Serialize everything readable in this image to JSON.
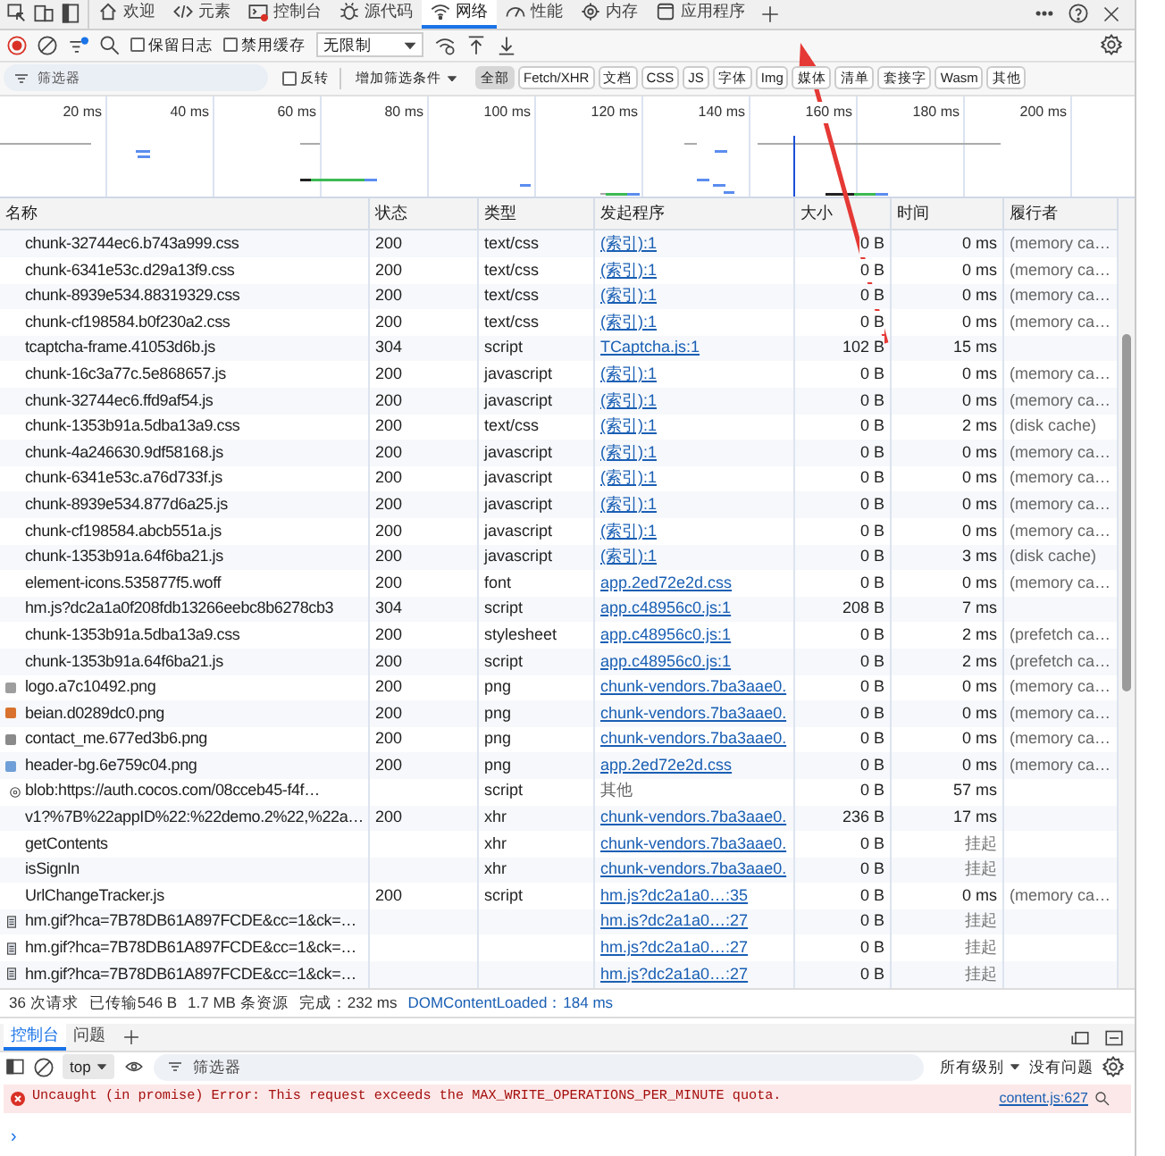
{
  "tabs": [
    {
      "label": "欢迎",
      "selected": false
    },
    {
      "label": "元素",
      "selected": false
    },
    {
      "label": "控制台",
      "selected": false
    },
    {
      "label": "源代码",
      "selected": false
    },
    {
      "label": "网络",
      "selected": true
    },
    {
      "label": "性能",
      "selected": false
    },
    {
      "label": "内存",
      "selected": false
    },
    {
      "label": "应用程序",
      "selected": false
    }
  ],
  "toolbar": {
    "preserve_log": {
      "label": "保留日志",
      "checked": false
    },
    "disable_cache": {
      "label": "禁用缓存",
      "checked": false
    },
    "throttling": "无限制"
  },
  "filter_bar": {
    "placeholder": "筛选器",
    "invert": {
      "label": "反转",
      "checked": false
    },
    "add_filter": "增加筛选条件",
    "chips": [
      {
        "label": "全部",
        "selected": true
      },
      {
        "label": "Fetch/XHR",
        "selected": false
      },
      {
        "label": "文档",
        "selected": false
      },
      {
        "label": "CSS",
        "selected": false
      },
      {
        "label": "JS",
        "selected": false
      },
      {
        "label": "字体",
        "selected": false
      },
      {
        "label": "Img",
        "selected": false
      },
      {
        "label": "媒体",
        "selected": false
      },
      {
        "label": "清单",
        "selected": false
      },
      {
        "label": "套接字",
        "selected": false
      },
      {
        "label": "Wasm",
        "selected": false
      },
      {
        "label": "其他",
        "selected": false
      }
    ]
  },
  "timeline": {
    "ticks": [
      "20 ms",
      "40 ms",
      "60 ms",
      "80 ms",
      "100 ms",
      "120 ms",
      "140 ms",
      "160 ms",
      "180 ms",
      "200 ms"
    ]
  },
  "table": {
    "columns": [
      "名称",
      "状态",
      "类型",
      "发起程序",
      "大小",
      "时间",
      "履行者"
    ],
    "rows": [
      {
        "kind": "plain",
        "name": "chunk-32744ec6.b743a999.css",
        "status": "200",
        "type": "text/css",
        "initiator": "(索引):1",
        "initiator_link": true,
        "size": "0 B",
        "time": "0 ms",
        "pending": false,
        "fulfiller": "(memory ca…"
      },
      {
        "kind": "plain",
        "name": "chunk-6341e53c.d29a13f9.css",
        "status": "200",
        "type": "text/css",
        "initiator": "(索引):1",
        "initiator_link": true,
        "size": "0 B",
        "time": "0 ms",
        "pending": false,
        "fulfiller": "(memory ca…"
      },
      {
        "kind": "plain",
        "name": "chunk-8939e534.88319329.css",
        "status": "200",
        "type": "text/css",
        "initiator": "(索引):1",
        "initiator_link": true,
        "size": "0 B",
        "time": "0 ms",
        "pending": false,
        "fulfiller": "(memory ca…"
      },
      {
        "kind": "plain",
        "name": "chunk-cf198584.b0f230a2.css",
        "status": "200",
        "type": "text/css",
        "initiator": "(索引):1",
        "initiator_link": true,
        "size": "0 B",
        "time": "0 ms",
        "pending": false,
        "fulfiller": "(memory ca…"
      },
      {
        "kind": "plain",
        "name": "tcaptcha-frame.41053d6b.js",
        "status": "304",
        "type": "script",
        "initiator": "TCaptcha.js:1",
        "initiator_link": true,
        "size": "102 B",
        "time": "15 ms",
        "pending": false
      },
      {
        "kind": "plain",
        "name": "chunk-16c3a77c.5e868657.js",
        "status": "200",
        "type": "javascript",
        "initiator": "(索引):1",
        "initiator_link": true,
        "size": "0 B",
        "time": "0 ms",
        "pending": false,
        "fulfiller": "(memory ca…"
      },
      {
        "kind": "plain",
        "name": "chunk-32744ec6.ffd9af54.js",
        "status": "200",
        "type": "javascript",
        "initiator": "(索引):1",
        "initiator_link": true,
        "size": "0 B",
        "time": "0 ms",
        "pending": false,
        "fulfiller": "(memory ca…"
      },
      {
        "kind": "plain",
        "name": "chunk-1353b91a.5dba13a9.css",
        "status": "200",
        "type": "text/css",
        "initiator": "(索引):1",
        "initiator_link": true,
        "size": "0 B",
        "time": "2 ms",
        "pending": false,
        "fulfiller": "(disk cache)"
      },
      {
        "kind": "plain",
        "name": "chunk-4a246630.9df58168.js",
        "status": "200",
        "type": "javascript",
        "initiator": "(索引):1",
        "initiator_link": true,
        "size": "0 B",
        "time": "0 ms",
        "pending": false,
        "fulfiller": "(memory ca…"
      },
      {
        "kind": "plain",
        "name": "chunk-6341e53c.a76d733f.js",
        "status": "200",
        "type": "javascript",
        "initiator": "(索引):1",
        "initiator_link": true,
        "size": "0 B",
        "time": "0 ms",
        "pending": false,
        "fulfiller": "(memory ca…"
      },
      {
        "kind": "plain",
        "name": "chunk-8939e534.877d6a25.js",
        "status": "200",
        "type": "javascript",
        "initiator": "(索引):1",
        "initiator_link": true,
        "size": "0 B",
        "time": "0 ms",
        "pending": false,
        "fulfiller": "(memory ca…"
      },
      {
        "kind": "plain",
        "name": "chunk-cf198584.abcb551a.js",
        "status": "200",
        "type": "javascript",
        "initiator": "(索引):1",
        "initiator_link": true,
        "size": "0 B",
        "time": "0 ms",
        "pending": false,
        "fulfiller": "(memory ca…"
      },
      {
        "kind": "plain",
        "name": "chunk-1353b91a.64f6ba21.js",
        "status": "200",
        "type": "javascript",
        "initiator": "(索引):1",
        "initiator_link": true,
        "size": "0 B",
        "time": "3 ms",
        "pending": false,
        "fulfiller": "(disk cache)"
      },
      {
        "kind": "plain",
        "name": "element-icons.535877f5.woff",
        "status": "200",
        "type": "font",
        "initiator": "app.2ed72e2d.css",
        "initiator_link": true,
        "size": "0 B",
        "time": "0 ms",
        "pending": false,
        "fulfiller": "(memory ca…"
      },
      {
        "kind": "plain",
        "name": "hm.js?dc2a1a0f208fdb13266eebc8b6278cb3",
        "status": "304",
        "type": "script",
        "initiator": "app.c48956c0.js:1",
        "initiator_link": true,
        "size": "208 B",
        "time": "7 ms",
        "pending": false
      },
      {
        "kind": "plain",
        "name": "chunk-1353b91a.5dba13a9.css",
        "status": "200",
        "type": "stylesheet",
        "initiator": "app.c48956c0.js:1",
        "initiator_link": true,
        "size": "0 B",
        "time": "2 ms",
        "pending": false,
        "fulfiller": "(prefetch ca…"
      },
      {
        "kind": "plain",
        "name": "chunk-1353b91a.64f6ba21.js",
        "status": "200",
        "type": "script",
        "initiator": "app.c48956c0.js:1",
        "initiator_link": true,
        "size": "0 B",
        "time": "2 ms",
        "pending": false,
        "fulfiller": "(prefetch ca…"
      },
      {
        "kind": "image",
        "name": "logo.a7c10492.png",
        "status": "200",
        "type": "png",
        "initiator": "chunk-vendors.7ba3aae0.",
        "initiator_link": true,
        "size": "0 B",
        "time": "0 ms",
        "pending": false,
        "fulfiller": "(memory ca…",
        "color": "#9e9e9e"
      },
      {
        "kind": "image",
        "name": "beian.d0289dc0.png",
        "status": "200",
        "type": "png",
        "initiator": "chunk-vendors.7ba3aae0.",
        "initiator_link": true,
        "size": "0 B",
        "time": "0 ms",
        "pending": false,
        "fulfiller": "(memory ca…",
        "color": "#d9722e"
      },
      {
        "kind": "image",
        "name": "contact_me.677ed3b6.png",
        "status": "200",
        "type": "png",
        "initiator": "chunk-vendors.7ba3aae0.",
        "initiator_link": true,
        "size": "0 B",
        "time": "0 ms",
        "pending": false,
        "fulfiller": "(memory ca…",
        "color": "#8a8a8a"
      },
      {
        "kind": "image",
        "name": "header-bg.6e759c04.png",
        "status": "200",
        "type": "png",
        "initiator": "app.2ed72e2d.css",
        "initiator_link": true,
        "size": "0 B",
        "time": "0 ms",
        "pending": false,
        "fulfiller": "(memory ca…",
        "color": "#6f9fd8"
      },
      {
        "kind": "blob",
        "name": "blob:https://auth.cocos.com/08cceb45-f4f…",
        "type": "script",
        "initiator": "其他",
        "initiator_link": false,
        "size": "0 B",
        "time": "57 ms",
        "pending": false
      },
      {
        "kind": "plain",
        "name": "v1?%7B%22appID%22:%22demo.2%22,%22a…",
        "status": "200",
        "type": "xhr",
        "initiator": "chunk-vendors.7ba3aae0.",
        "initiator_link": true,
        "size": "236 B",
        "time": "17 ms",
        "pending": false
      },
      {
        "kind": "plain",
        "name": "getContents",
        "type": "xhr",
        "initiator": "chunk-vendors.7ba3aae0.",
        "initiator_link": true,
        "size": "0 B",
        "time": "挂起",
        "pending": true
      },
      {
        "kind": "plain",
        "name": "isSignIn",
        "type": "xhr",
        "initiator": "chunk-vendors.7ba3aae0.",
        "initiator_link": true,
        "size": "0 B",
        "time": "挂起",
        "pending": true
      },
      {
        "kind": "plain",
        "name": "UrlChangeTracker.js",
        "status": "200",
        "type": "script",
        "initiator": "hm.js?dc2a1a0…:35",
        "initiator_link": true,
        "size": "0 B",
        "time": "0 ms",
        "pending": false,
        "fulfiller": "(memory ca…"
      },
      {
        "kind": "file",
        "name": "hm.gif?hca=7B78DB61A897FCDE&cc=1&ck=…",
        "initiator": "hm.js?dc2a1a0…:27",
        "initiator_link": true,
        "size": "0 B",
        "time": "挂起",
        "pending": true
      },
      {
        "kind": "file",
        "name": "hm.gif?hca=7B78DB61A897FCDE&cc=1&ck=…",
        "initiator": "hm.js?dc2a1a0…:27",
        "initiator_link": true,
        "size": "0 B",
        "time": "挂起",
        "pending": true
      },
      {
        "kind": "file",
        "name": "hm.gif?hca=7B78DB61A897FCDE&cc=1&ck=…",
        "initiator": "hm.js?dc2a1a0…:27",
        "initiator_link": true,
        "size": "0 B",
        "time": "挂起",
        "pending": true
      }
    ]
  },
  "status_bar": {
    "items": [
      "36 次请求",
      "已传输546 B",
      "1.7 MB 条资源",
      "完成：232 ms"
    ],
    "dom_loaded": "DOMContentLoaded：184 ms"
  },
  "drawer": {
    "tabs": [
      {
        "label": "控制台",
        "selected": true
      },
      {
        "label": "问题",
        "selected": false
      }
    ],
    "context": "top",
    "placeholder": "筛选器",
    "levels": "所有级别",
    "issues": "没有问题",
    "messages": [
      {
        "kind": "error",
        "text": "Uncaught (in promise) Error: This request exceeds the MAX_WRITE_OPERATIONS_PER_MINUTE quota.",
        "source": "content.js:627"
      }
    ],
    "prompt": "›"
  }
}
